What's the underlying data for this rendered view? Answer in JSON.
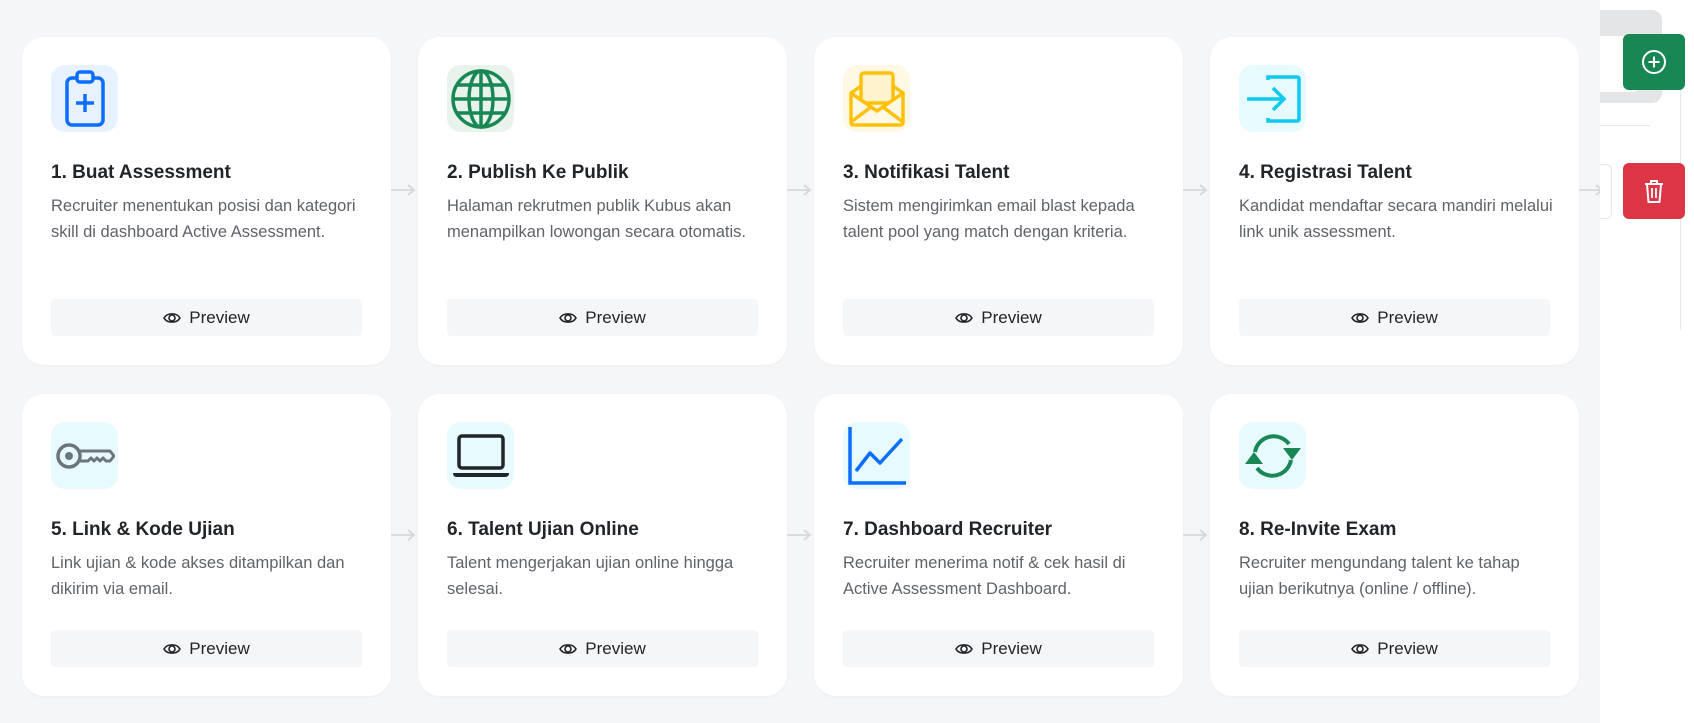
{
  "steps": [
    {
      "title": "1. Buat Assessment",
      "description": "Recruiter menentukan posisi dan kategori skill di dashboard Active Assessment.",
      "button": "Preview",
      "icon": "clipboard-plus-icon",
      "color": "#0d6efd",
      "bg": "#e7f1ff"
    },
    {
      "title": "2. Publish Ke Publik",
      "description": "Halaman rekrutmen publik Kubus akan menampilkan lowongan secara otomatis.",
      "button": "Preview",
      "icon": "globe-icon",
      "color": "#198754",
      "bg": "#e8f3ec"
    },
    {
      "title": "3. Notifikasi Talent",
      "description": "Sistem mengirimkan email blast kepada talent pool yang match dengan kriteria.",
      "button": "Preview",
      "icon": "envelope-open-icon",
      "color": "#ffc107",
      "bg": "#fff8e5"
    },
    {
      "title": "4. Registrasi Talent",
      "description": "Kandidat mendaftar secara mandiri melalui link unik assessment.",
      "button": "Preview",
      "icon": "box-arrow-in-right-icon",
      "color": "#0dcaf0",
      "bg": "#e7fafe"
    },
    {
      "title": "5. Link & Kode Ujian",
      "description": "Link ujian & kode akses ditampilkan dan dikirim via email.",
      "button": "Preview",
      "icon": "key-icon",
      "color": "#6c757d",
      "bg": "#e7fafe"
    },
    {
      "title": "6. Talent Ujian Online",
      "description": "Talent mengerjakan ujian online hingga selesai.",
      "button": "Preview",
      "icon": "laptop-icon",
      "color": "#212529",
      "bg": "#e7fafe"
    },
    {
      "title": "7. Dashboard Recruiter",
      "description": "Recruiter menerima notif & cek hasil di Active Assessment Dashboard.",
      "button": "Preview",
      "icon": "graph-up-icon",
      "color": "#0d6efd",
      "bg": "#e7fafe"
    },
    {
      "title": "8. Re-Invite Exam",
      "description": "Recruiter mengundang talent ke tahap ujian berikutnya (online / offline).",
      "button": "Preview",
      "icon": "arrow-repeat-icon",
      "color": "#198754",
      "bg": "#e7fafe"
    }
  ],
  "sidebar": {
    "add_icon": "plus-circle-icon",
    "delete_icon": "trash-icon",
    "add_color": "#198754",
    "delete_color": "#dc3545"
  }
}
